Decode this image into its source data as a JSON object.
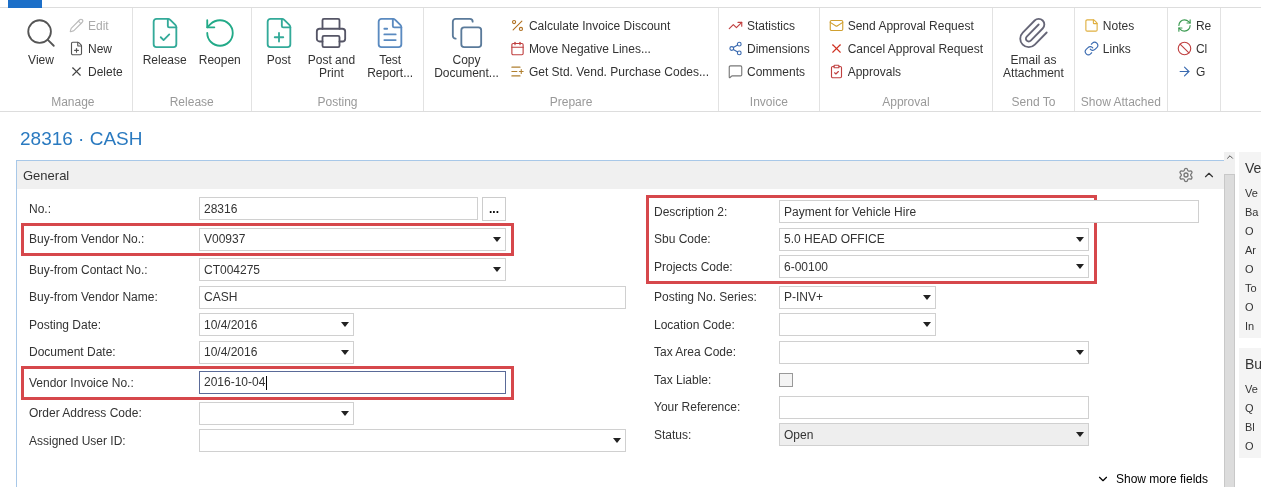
{
  "ribbon": {
    "groups": [
      {
        "label": "Manage",
        "items": [
          {
            "label": "View",
            "kind": "large",
            "disabled": false
          },
          {
            "label": "Edit",
            "kind": "small",
            "disabled": true
          },
          {
            "label": "New",
            "kind": "small",
            "disabled": false
          },
          {
            "label": "Delete",
            "kind": "small",
            "disabled": false
          }
        ]
      },
      {
        "label": "Release",
        "items": [
          {
            "label": "Release",
            "kind": "large",
            "disabled": false
          },
          {
            "label": "Reopen",
            "kind": "large",
            "disabled": false
          }
        ]
      },
      {
        "label": "Posting",
        "items": [
          {
            "label": "Post",
            "kind": "large",
            "disabled": false
          },
          {
            "label": "Post and\nPrint",
            "kind": "large",
            "disabled": false
          },
          {
            "label": "Test\nReport...",
            "kind": "large",
            "disabled": false
          }
        ]
      },
      {
        "label": "Prepare",
        "items": [
          {
            "label": "Copy\nDocument...",
            "kind": "large",
            "disabled": false
          },
          {
            "label": "Calculate Invoice Discount",
            "kind": "small",
            "disabled": false
          },
          {
            "label": "Move Negative Lines...",
            "kind": "small",
            "disabled": false
          },
          {
            "label": "Get Std. Vend. Purchase Codes...",
            "kind": "small",
            "disabled": false
          }
        ]
      },
      {
        "label": "Invoice",
        "items": [
          {
            "label": "Statistics",
            "kind": "small",
            "disabled": false
          },
          {
            "label": "Dimensions",
            "kind": "small",
            "disabled": false
          },
          {
            "label": "Comments",
            "kind": "small",
            "disabled": false
          }
        ]
      },
      {
        "label": "Approval",
        "items": [
          {
            "label": "Send Approval Request",
            "kind": "small",
            "disabled": false
          },
          {
            "label": "Cancel Approval Request",
            "kind": "small",
            "disabled": false
          },
          {
            "label": "Approvals",
            "kind": "small",
            "disabled": false
          }
        ]
      },
      {
        "label": "Send To",
        "items": [
          {
            "label": "Email as\nAttachment",
            "kind": "large",
            "disabled": false
          }
        ]
      },
      {
        "label": "Show Attached",
        "items": [
          {
            "label": "Notes",
            "kind": "small",
            "disabled": false
          },
          {
            "label": "Links",
            "kind": "small",
            "disabled": false
          }
        ]
      },
      {
        "items": [
          {
            "label": "Re",
            "kind": "small",
            "disabled": false
          },
          {
            "label": "Cl",
            "kind": "small",
            "disabled": false
          },
          {
            "label": "G",
            "kind": "small",
            "disabled": false
          }
        ]
      }
    ]
  },
  "page_title": "28316 · CASH",
  "section": {
    "title": "General",
    "expanded": true,
    "show_more": "Show more fields",
    "columns": [
      [
        {
          "label": "No.:",
          "value": "28316",
          "kind": "lookup",
          "button": "...",
          "highlighted": false,
          "focused": false,
          "editable": true
        },
        {
          "label": "Buy-from Vendor No.:",
          "value": "V00937",
          "kind": "dropdown",
          "highlighted": true,
          "focused": false,
          "editable": true
        },
        {
          "label": "Buy-from Contact No.:",
          "value": "CT004275",
          "kind": "dropdown",
          "highlighted": false,
          "focused": false,
          "editable": true
        },
        {
          "label": "Buy-from Vendor Name:",
          "value": "CASH",
          "kind": "text",
          "highlighted": false,
          "focused": false,
          "editable": true
        },
        {
          "label": "Posting Date:",
          "value": "10/4/2016",
          "kind": "dropdown",
          "highlighted": false,
          "focused": false,
          "editable": true
        },
        {
          "label": "Document Date:",
          "value": "10/4/2016",
          "kind": "dropdown",
          "highlighted": false,
          "focused": false,
          "editable": true
        },
        {
          "label": "Vendor Invoice No.:",
          "value": "2016-10-04",
          "kind": "text",
          "highlighted": true,
          "focused": true,
          "editable": true
        },
        {
          "label": "Order Address Code:",
          "kind": "dropdown",
          "highlighted": false,
          "focused": false,
          "editable": true
        },
        {
          "label": "Assigned User ID:",
          "kind": "dropdown",
          "highlighted": false,
          "focused": false,
          "editable": true
        }
      ],
      [
        {
          "label": "Description 2:",
          "value": "Payment for Vehicle Hire",
          "kind": "text",
          "highlighted": true,
          "focused": false,
          "editable": true
        },
        {
          "label": "Sbu Code:",
          "value": "5.0 HEAD OFFICE",
          "kind": "dropdown",
          "highlighted": true,
          "focused": false,
          "editable": true
        },
        {
          "label": "Projects Code:",
          "value": "6-00100",
          "kind": "dropdown",
          "highlighted": true,
          "focused": false,
          "editable": true
        },
        {
          "label": "Posting No. Series:",
          "value": "P-INV+",
          "kind": "dropdown",
          "highlighted": false,
          "focused": false,
          "editable": true
        },
        {
          "label": "Location Code:",
          "kind": "dropdown",
          "highlighted": false,
          "focused": false,
          "editable": true
        },
        {
          "label": "Tax Area Code:",
          "kind": "dropdown",
          "highlighted": false,
          "focused": false,
          "editable": true
        },
        {
          "label": "Tax Liable:",
          "kind": "checkbox",
          "checked": false,
          "highlighted": false,
          "focused": false,
          "editable": true
        },
        {
          "label": "Your Reference:",
          "kind": "text",
          "highlighted": false,
          "focused": false,
          "editable": true
        },
        {
          "label": "Status:",
          "value": "Open",
          "kind": "dropdown",
          "highlighted": false,
          "focused": false,
          "editable": false
        }
      ]
    ]
  },
  "factboxes": [
    {
      "title": "Ve",
      "lines": [
        "Ve",
        "Ba",
        "O",
        "Ar",
        "O",
        "To",
        "O",
        "In"
      ]
    },
    {
      "title": "Bu",
      "lines": [
        "Ve",
        "Q",
        "Bl",
        "O"
      ]
    }
  ]
}
